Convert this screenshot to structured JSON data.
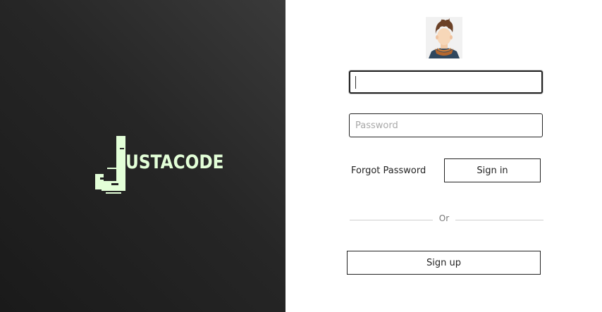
{
  "brand": {
    "logo_text": "USTACODE",
    "accent_color": "#e3ffd8"
  },
  "login": {
    "avatar_icon": "user-avatar-icon",
    "username_value": "",
    "password_placeholder": "Password",
    "forgot_password_label": "Forgot Password",
    "signin_label": "Sign in",
    "divider_label": "Or",
    "signup_label": "Sign up"
  }
}
